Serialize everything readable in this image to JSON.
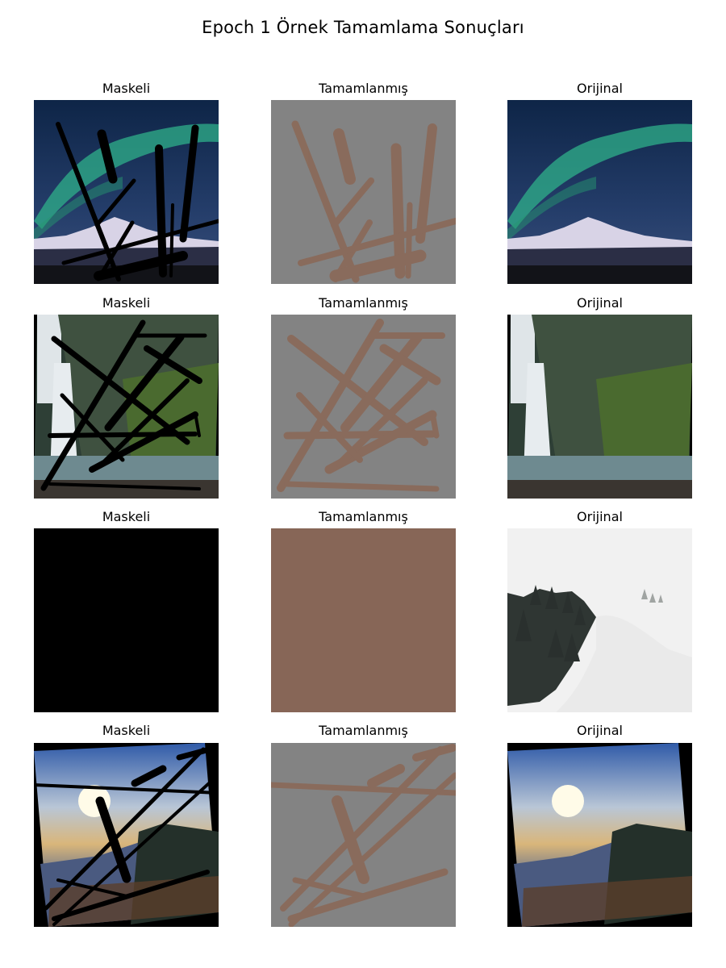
{
  "figure": {
    "title": "Epoch 1 Örnek Tamamlama Sonuçları",
    "column_titles": [
      "Maskeli",
      "Tamamlanmış",
      "Orijinal"
    ],
    "rows": [
      {
        "scene": "aurora-mountain",
        "masked_label": "Maskeli",
        "completed_label": "Tamamlanmış",
        "original_label": "Orijinal"
      },
      {
        "scene": "waterfall-cliff",
        "masked_label": "Maskeli",
        "completed_label": "Tamamlanmış",
        "original_label": "Orijinal"
      },
      {
        "scene": "foggy-forest",
        "masked_label": "Maskeli",
        "completed_label": "Tamamlanmış",
        "original_label": "Orijinal"
      },
      {
        "scene": "sunset-mountains",
        "masked_label": "Maskeli",
        "completed_label": "Tamamlanmış",
        "original_label": "Orijinal"
      }
    ],
    "colors": {
      "mask_stroke": "#000000",
      "completed_background": "#838383",
      "completed_stroke": "#8a6a5a",
      "completed_full_fill": "#876657"
    }
  }
}
